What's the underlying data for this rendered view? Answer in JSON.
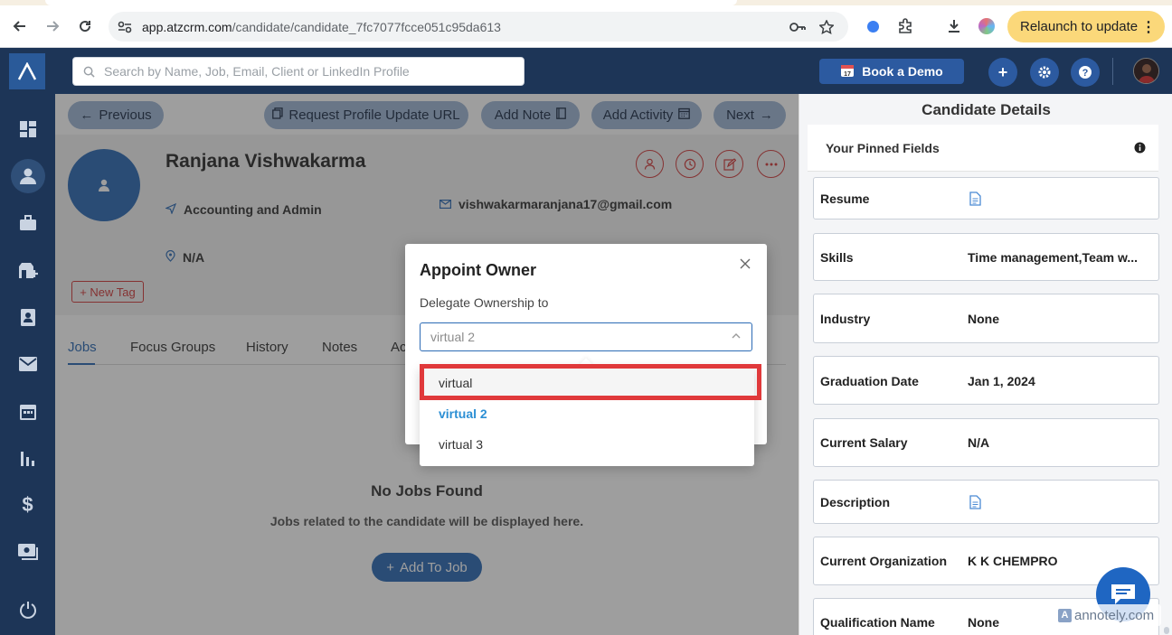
{
  "browser": {
    "url_host": "app.atzcrm.com",
    "url_path": "/candidate/candidate_7fc7077fcce051c95da613",
    "relaunch_label": "Relaunch to update"
  },
  "appbar": {
    "search_placeholder": "Search by Name, Job, Email, Client or LinkedIn Profile",
    "book_demo_label": "Book a Demo"
  },
  "sidebar": {
    "items": [
      "dashboard-icon",
      "candidates-icon",
      "jobs-icon",
      "clients-icon",
      "contacts-icon",
      "mail-icon",
      "calendar-icon",
      "reports-icon",
      "billing-icon",
      "payments-icon"
    ]
  },
  "toolbar": {
    "previous_label": "Previous",
    "request_update_label": "Request Profile Update URL",
    "add_note_label": "Add Note",
    "add_activity_label": "Add Activity",
    "next_label": "Next"
  },
  "candidate": {
    "name": "Ranjana Vishwakarma",
    "industry": "Accounting and Admin",
    "email": "vishwakarmaranjana17@gmail.com",
    "location": "N/A",
    "new_tag_label": "+ New Tag"
  },
  "tabs": {
    "items": [
      "Jobs",
      "Focus Groups",
      "History",
      "Notes",
      "Ac"
    ],
    "active": "Jobs"
  },
  "empty_state": {
    "title": "No Jobs Found",
    "subtitle": "Jobs related to the candidate will be displayed here.",
    "add_to_job_label": "Add To Job"
  },
  "right_panel": {
    "title": "Candidate Details",
    "pinned_label": "Your Pinned Fields",
    "fields": [
      {
        "key": "Resume",
        "value": ""
      },
      {
        "key": "Skills",
        "value": "Time management,Team w..."
      },
      {
        "key": "Industry",
        "value": "None"
      },
      {
        "key": "Graduation Date",
        "value": "Jan 1, 2024"
      },
      {
        "key": "Current Salary",
        "value": "N/A"
      },
      {
        "key": "Description",
        "value": ""
      },
      {
        "key": "Current Organization",
        "value": "K K CHEMPRO"
      },
      {
        "key": "Qualification Name",
        "value": "None"
      }
    ]
  },
  "modal": {
    "title": "Appoint Owner",
    "label": "Delegate Ownership to",
    "selected_value": "virtual 2",
    "options": [
      "virtual",
      "virtual 2",
      "virtual 3"
    ]
  },
  "watermark": {
    "text": "annotely.com"
  },
  "colors": {
    "navy": "#1d3557",
    "accent": "#2c6bb5",
    "highlight": "#e0393b",
    "relaunch": "#fbd87a"
  }
}
